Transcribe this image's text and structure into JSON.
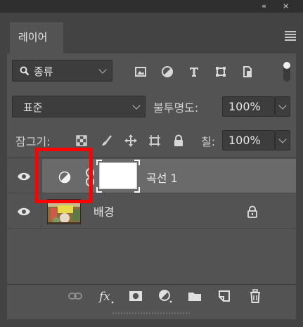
{
  "window": {
    "collapse_label": "«",
    "close_label": "×"
  },
  "tabs": [
    {
      "label": "레이어"
    }
  ],
  "filter": {
    "kind_label": "종류",
    "icons": [
      "image-filter-icon",
      "adjustment-filter-icon",
      "type-filter-icon",
      "shape-filter-icon",
      "smart-object-filter-icon"
    ]
  },
  "blend": {
    "mode": "표준",
    "opacity_label": "불투명도:",
    "opacity_value": "100%"
  },
  "lock": {
    "label": "잠그기:",
    "fill_label": "칠:",
    "fill_value": "100%"
  },
  "layers": [
    {
      "name": "곡선 1",
      "type": "adjustment",
      "selected": true
    },
    {
      "name": "배경",
      "type": "background",
      "selected": false,
      "locked": true
    }
  ],
  "colors": {
    "panel": "#535353",
    "selected_row": "#6a6a6a",
    "annotation": "#ff0000"
  }
}
